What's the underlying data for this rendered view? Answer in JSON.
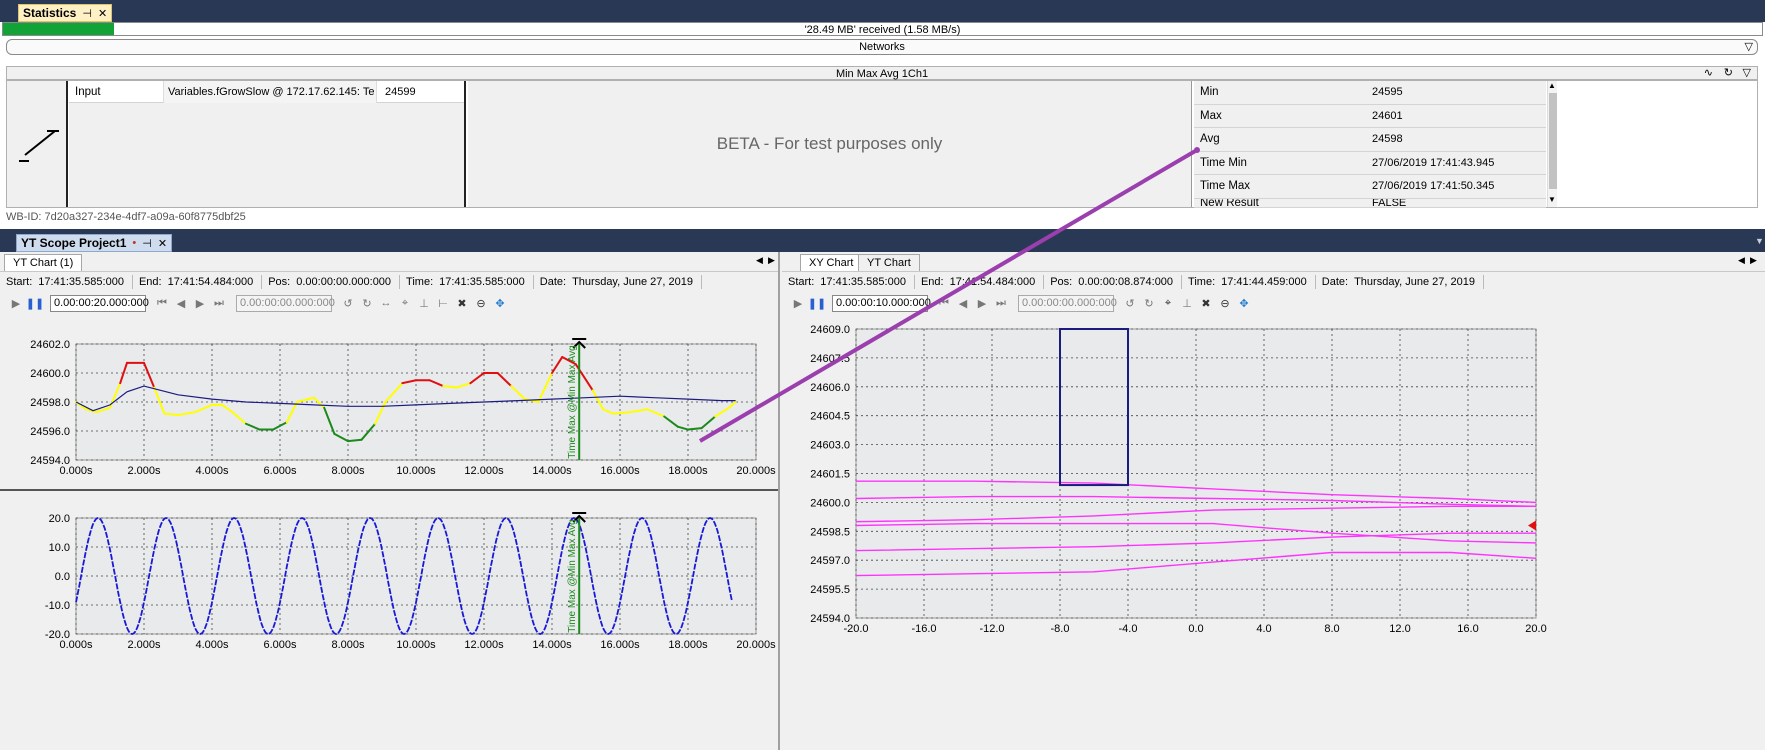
{
  "statistics": {
    "tab_title": "Statistics",
    "received_text": "'28.49 MB' received (1.58 MB/s)",
    "received_progress": 0.063,
    "networks_label": "Networks",
    "minmax_title": "Min Max Avg 1Ch1",
    "input_label": "Input",
    "input_variable": "Variables.fGrowSlow @ 172.17.62.145: Te",
    "input_value": "24599",
    "beta_text": "BETA - For test purposes only",
    "results": [
      {
        "name": "Min",
        "value": "24595"
      },
      {
        "name": "Max",
        "value": "24601"
      },
      {
        "name": "Avg",
        "value": "24598"
      },
      {
        "name": "Time Min",
        "value": "27/06/2019 17:41:43.945"
      },
      {
        "name": "Time Max",
        "value": "27/06/2019 17:41:50.345"
      },
      {
        "name": "New Result",
        "value": "FALSE"
      }
    ],
    "wb_id": "WB-ID: 7d20a327-234e-4df7-a09a-60f8775dbf25"
  },
  "scope": {
    "tab_title": "YT Scope Project1",
    "left": {
      "tab": "YT Chart  (1)",
      "start_label": "Start:",
      "start": "17:41:35.585:000",
      "end_label": "End:",
      "end": "17:41:54.484:000",
      "pos_label": "Pos:",
      "pos": "0.00:00:00.000:000",
      "time_label": "Time:",
      "time": "17:41:35.585:000",
      "date_label": "Date:",
      "date": "Thursday, June 27, 2019",
      "span_value": "0.00:00:20.000:000",
      "pos_value": "0.00:00:00.000:000"
    },
    "right": {
      "tabs": [
        "XY Chart",
        "YT Chart"
      ],
      "start_label": "Start:",
      "start": "17:41:35.585:000",
      "end_label": "End:",
      "end": "17:41:54.484:000",
      "pos_label": "Pos:",
      "pos": "0.00:00:08.874:000",
      "time_label": "Time:",
      "time": "17:41:44.459:000",
      "date_label": "Date:",
      "date": "Thursday, June 27, 2019",
      "span_value": "0.00:00:10.000:000",
      "pos_value": "0.00:00:00.000:000"
    }
  },
  "colors": {
    "accent_tab": "#fff1c6",
    "progress": "#12a336",
    "trace_red": "#e01010",
    "trace_yellow": "#ffff00",
    "trace_green": "#1a8a1a",
    "trace_navy": "#1c1c80",
    "sine": "#1a1ad6",
    "xy_trace": "#ff33ff",
    "marker": "#1c8a1c",
    "connector": "#9b3fae"
  },
  "chart_data": [
    {
      "type": "line",
      "title": "",
      "xlim": [
        0,
        20
      ],
      "ylim": [
        24594,
        24602
      ],
      "x_ticks": [
        "0.000s",
        "2.000s",
        "4.000s",
        "6.000s",
        "8.000s",
        "10.000s",
        "12.000s",
        "14.000s",
        "16.000s",
        "18.000s",
        "20.000s"
      ],
      "y_ticks": [
        "24594.0",
        "24596.0",
        "24598.0",
        "24600.0",
        "24602.0"
      ],
      "marker_label": "Time Max @Min Max Avg",
      "marker_x": 14.8,
      "series": [
        {
          "x": [
            0,
            0.3,
            0.6,
            1.0,
            1.3,
            1.5,
            2.0,
            2.3,
            2.6,
            3.0,
            3.5,
            4.0,
            4.3,
            4.6,
            5.0,
            5.4,
            5.8,
            6.2,
            6.5,
            7.0,
            7.3,
            7.6,
            8.0,
            8.4,
            8.8,
            9.1,
            9.6,
            10.0,
            10.4,
            10.8,
            11.2,
            11.6,
            12.0,
            12.4,
            12.8,
            13.2,
            13.6,
            14.0,
            14.3,
            14.7,
            15.2,
            15.5,
            15.8,
            16.3,
            16.8,
            17.3,
            17.7,
            18.0,
            18.4,
            18.8,
            19.2,
            19.4
          ],
          "y": [
            24598.0,
            24597.5,
            24597.3,
            24597.6,
            24599.3,
            24600.7,
            24600.7,
            24599.0,
            24597.2,
            24597.1,
            24597.3,
            24597.8,
            24597.8,
            24597.3,
            24596.5,
            24596.1,
            24596.1,
            24596.6,
            24598.0,
            24598.3,
            24597.6,
            24595.8,
            24595.3,
            24595.4,
            24596.5,
            24598.0,
            24599.3,
            24599.5,
            24599.5,
            24599.1,
            24599.0,
            24599.3,
            24600.0,
            24600.0,
            24599.1,
            24598.2,
            24598.0,
            24600.0,
            24601.1,
            24600.6,
            24598.8,
            24597.5,
            24597.2,
            24597.3,
            24597.5,
            24597.0,
            24596.3,
            24596.1,
            24596.2,
            24597.0,
            24597.6,
            24598.0
          ]
        },
        {
          "x": [
            0,
            0.5,
            1.0,
            1.5,
            2.0,
            2.5,
            3.0,
            4.0,
            5.0,
            6.0,
            7.0,
            8.0,
            9.0,
            10.0,
            11.0,
            12.0,
            13.0,
            14.0,
            15.0,
            16.0,
            17.0,
            18.0,
            19.0,
            19.4
          ],
          "y": [
            24598.0,
            24597.4,
            24597.8,
            24598.7,
            24599.1,
            24598.8,
            24598.5,
            24598.2,
            24598.0,
            24597.9,
            24597.8,
            24597.7,
            24597.7,
            24597.8,
            24597.9,
            24598.0,
            24598.1,
            24598.2,
            24598.3,
            24598.4,
            24598.3,
            24598.2,
            24598.1,
            24598.1
          ]
        }
      ]
    },
    {
      "type": "line",
      "title": "",
      "xlim": [
        0,
        20
      ],
      "ylim": [
        -20,
        20
      ],
      "x_ticks": [
        "0.000s",
        "2.000s",
        "4.000s",
        "6.000s",
        "8.000s",
        "10.000s",
        "12.000s",
        "14.000s",
        "16.000s",
        "18.000s",
        "20.000s"
      ],
      "y_ticks": [
        "-20.0",
        "-10.0",
        "0.0",
        "10.0",
        "20.0"
      ],
      "marker_label": "Time Max @Min Max Avg",
      "marker_x": 14.8,
      "series": [
        {
          "function": "20*sin(2*pi*(x-0.05)/2)",
          "x_range": [
            0,
            19.3
          ],
          "amplitude": 20,
          "period": 2.0,
          "peaks_x": [
            1.6,
            3.6,
            5.6,
            7.6,
            9.6,
            11.6,
            13.6,
            15.6,
            17.6
          ]
        }
      ]
    },
    {
      "type": "scatter",
      "title": "",
      "xlim": [
        -20,
        20
      ],
      "ylim": [
        24594,
        24609
      ],
      "x_ticks": [
        "-20.0",
        "-16.0",
        "-12.0",
        "-8.0",
        "-4.0",
        "0.0",
        "4.0",
        "8.0",
        "12.0",
        "16.0",
        "20.0"
      ],
      "y_ticks": [
        "24594.0",
        "24595.5",
        "24597.0",
        "24598.5",
        "24600.0",
        "24601.5",
        "24603.0",
        "24604.5",
        "24606.0",
        "24607.5",
        "24609.0"
      ],
      "box": {
        "x": [
          -8,
          -4
        ],
        "y": [
          24600.9,
          24609
        ]
      },
      "traces_y": [
        [
          24601.1,
          24601.1,
          24601.0,
          24600.7,
          24600.4,
          24600.2,
          24600.0
        ],
        [
          24600.2,
          24600.3,
          24600.3,
          24600.2,
          24600.1,
          24599.9,
          24599.8
        ],
        [
          24599.0,
          24599.1,
          24599.3,
          24599.6,
          24599.7,
          24599.8,
          24599.8
        ],
        [
          24598.8,
          24598.9,
          24598.9,
          24598.9,
          24598.4,
          24598.0,
          24597.9
        ],
        [
          24597.5,
          24597.6,
          24597.7,
          24597.9,
          24598.2,
          24598.4,
          24598.4
        ],
        [
          24596.2,
          24596.3,
          24596.4,
          24596.9,
          24597.4,
          24597.4,
          24597.1
        ]
      ],
      "traces_x": [
        -20,
        -13,
        -6,
        1,
        8,
        15,
        20
      ],
      "cursor_y": 24598.8
    }
  ]
}
